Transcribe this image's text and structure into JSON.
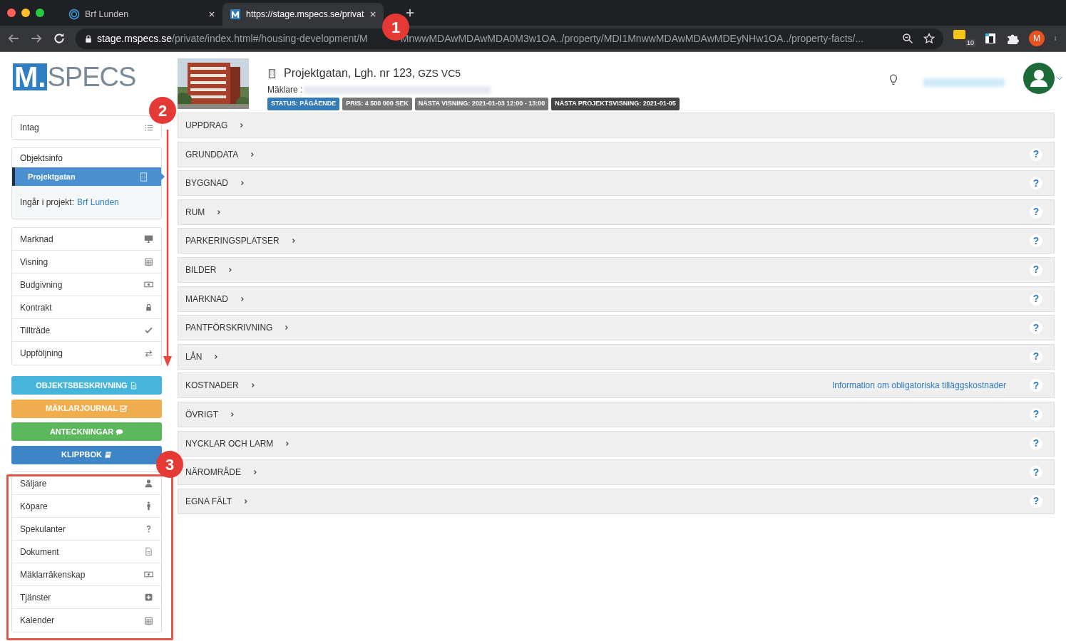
{
  "browser": {
    "tabs": [
      {
        "title": "Brf Lunden",
        "selected": false
      },
      {
        "title": "https://stage.mspecs.se/privat",
        "selected": true
      }
    ],
    "url": {
      "host": "stage.mspecs.se",
      "path_start": "/private/index.html#/housing-development/M",
      "path_end": "MnwwMDAwMDAwMDA0M3w1OA../property/MDI1MnwwMDAwMDAwMDEyNHw1OA../property-facts/..."
    },
    "extension_badge": "10",
    "profile_initial": "M"
  },
  "logo": {
    "mark": "M.",
    "text": "SPECS"
  },
  "header": {
    "title": "Projektgatan, Lgh. nr 123,",
    "code": "GZS VC5",
    "broker_label": "Mäklare :",
    "badges": [
      {
        "text": "STATUS: PÅGÅENDE",
        "color": "#337ab7"
      },
      {
        "text": "PRIS:  4 500 000 SEK",
        "color": "#777777"
      },
      {
        "text": "NÄSTA VISNING: 2021-01-03 12:00 - 13:00",
        "color": "#777777"
      },
      {
        "text": "NÄSTA PROJEKTSVISNING: 2021-01-05",
        "color": "#444444"
      }
    ]
  },
  "sidebar": {
    "intake": {
      "label": "Intag"
    },
    "object_info": {
      "heading": "Objektsinfo",
      "item": {
        "label": "Projektgatan",
        "selected": true
      },
      "project_label": "Ingår i projekt:",
      "project_link": "Brf Lunden"
    },
    "process": [
      {
        "label": "Marknad"
      },
      {
        "label": "Visning"
      },
      {
        "label": "Budgivning"
      },
      {
        "label": "Kontrakt"
      },
      {
        "label": "Tillträde"
      },
      {
        "label": "Uppföljning"
      }
    ],
    "buttons": [
      {
        "label": "OBJEKTSBESKRIVNING",
        "color": "#45b5dc"
      },
      {
        "label": "MÄKLARJOURNAL",
        "color": "#f0ad4e"
      },
      {
        "label": "ANTECKNINGAR",
        "color": "#5cb85c"
      },
      {
        "label": "KLIPPBOK",
        "color": "#3d85c6"
      }
    ],
    "people": [
      {
        "label": "Säljare"
      },
      {
        "label": "Köpare"
      },
      {
        "label": "Spekulanter"
      },
      {
        "label": "Dokument"
      },
      {
        "label": "Mäklarräkenskap"
      },
      {
        "label": "Tjänster"
      },
      {
        "label": "Kalender"
      }
    ]
  },
  "sections": [
    {
      "title": "UPPDRAG"
    },
    {
      "title": "GRUNDDATA",
      "help": "?"
    },
    {
      "title": "BYGGNAD",
      "help": "?"
    },
    {
      "title": "RUM",
      "help": "?"
    },
    {
      "title": "PARKERINGSPLATSER",
      "help": "?"
    },
    {
      "title": "BILDER",
      "help": "?"
    },
    {
      "title": "MARKNAD",
      "help": "?"
    },
    {
      "title": "PANTFÖRSKRIVNING",
      "help": "?"
    },
    {
      "title": "LÅN",
      "help": "?"
    },
    {
      "title": "KOSTNADER",
      "help": "?",
      "link": "Information om obligatoriska tilläggskostnader"
    },
    {
      "title": "ÖVRIGT",
      "help": "?"
    },
    {
      "title": "NYCKLAR OCH LARM",
      "help": "?"
    },
    {
      "title": "NÄROMRÅDE",
      "help": "?"
    },
    {
      "title": "EGNA FÄLT",
      "help": "?"
    }
  ],
  "callouts": [
    "1",
    "2",
    "3"
  ]
}
